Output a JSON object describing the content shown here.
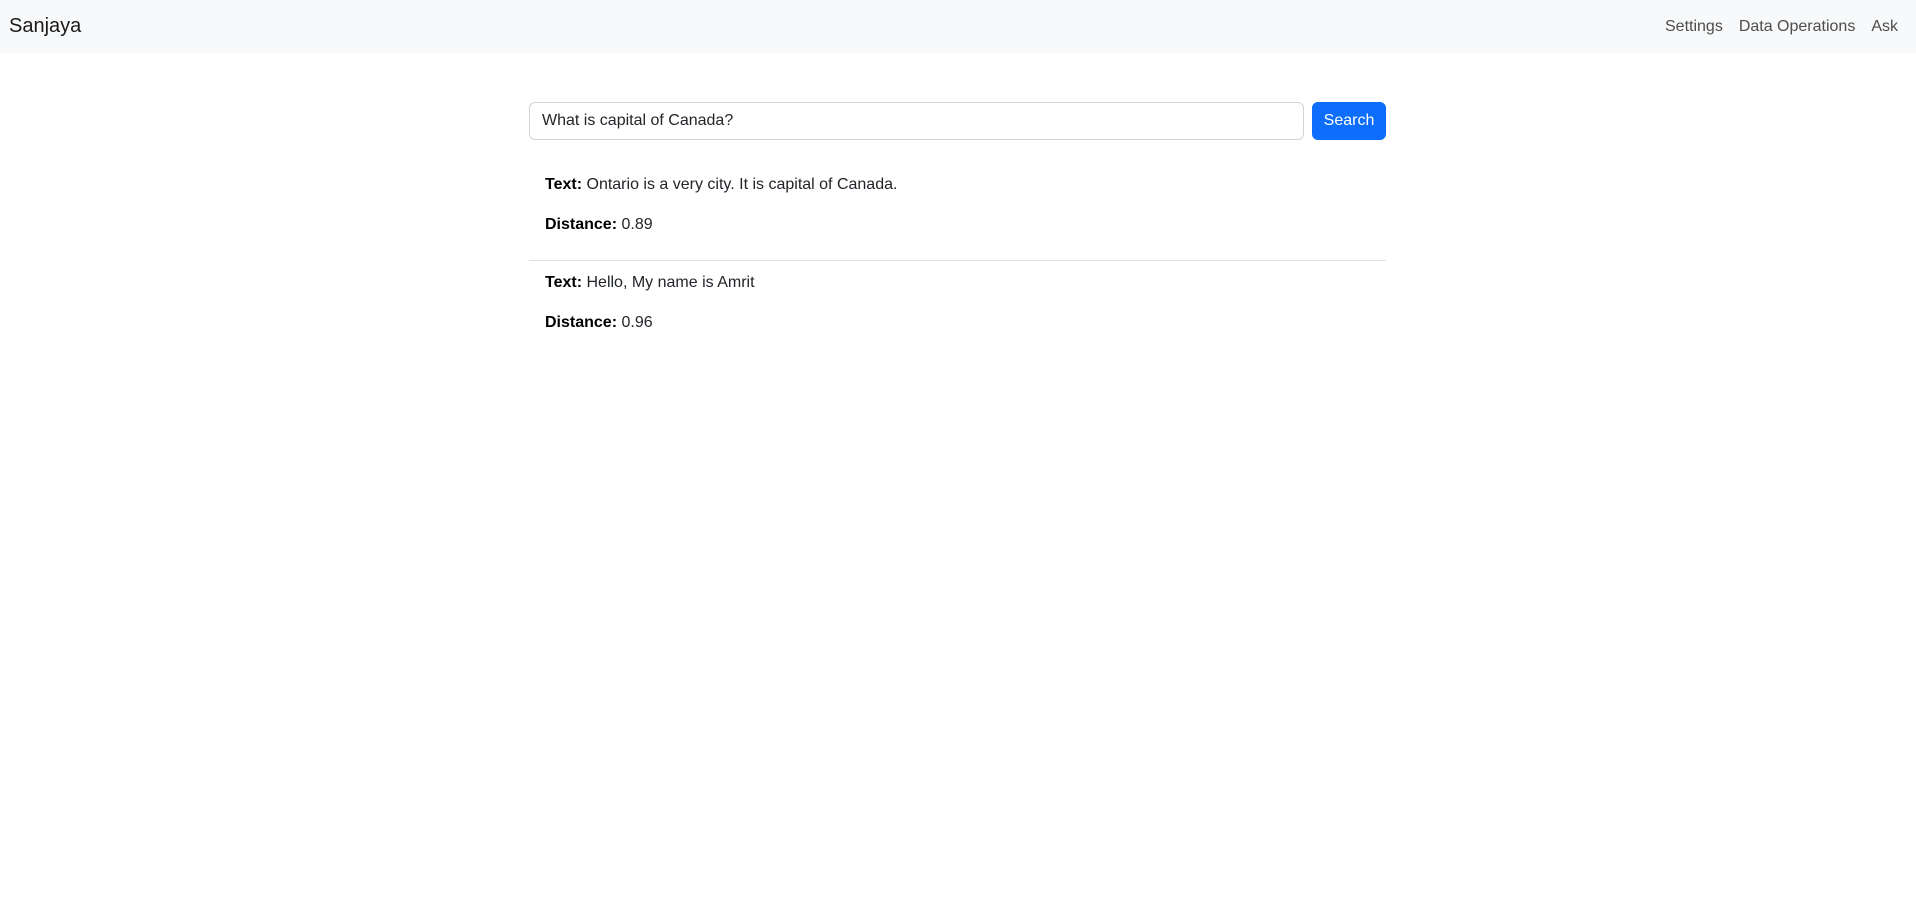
{
  "navbar": {
    "brand": "Sanjaya",
    "links": [
      "Settings",
      "Data Operations",
      "Ask"
    ]
  },
  "search": {
    "value": "What is capital of Canada?",
    "button_label": "Search"
  },
  "results": [
    {
      "text_label": "Text:",
      "text_value": " Ontario is a very city. It is capital of Canada.",
      "distance_label": "Distance:",
      "distance_value": " 0.89"
    },
    {
      "text_label": "Text:",
      "text_value": " Hello, My name is Amrit",
      "distance_label": "Distance:",
      "distance_value": " 0.96"
    }
  ],
  "colors": {
    "navbar_bg": "#f8f9fa",
    "primary": "#0d6efd",
    "divider": "#dee2e6"
  }
}
